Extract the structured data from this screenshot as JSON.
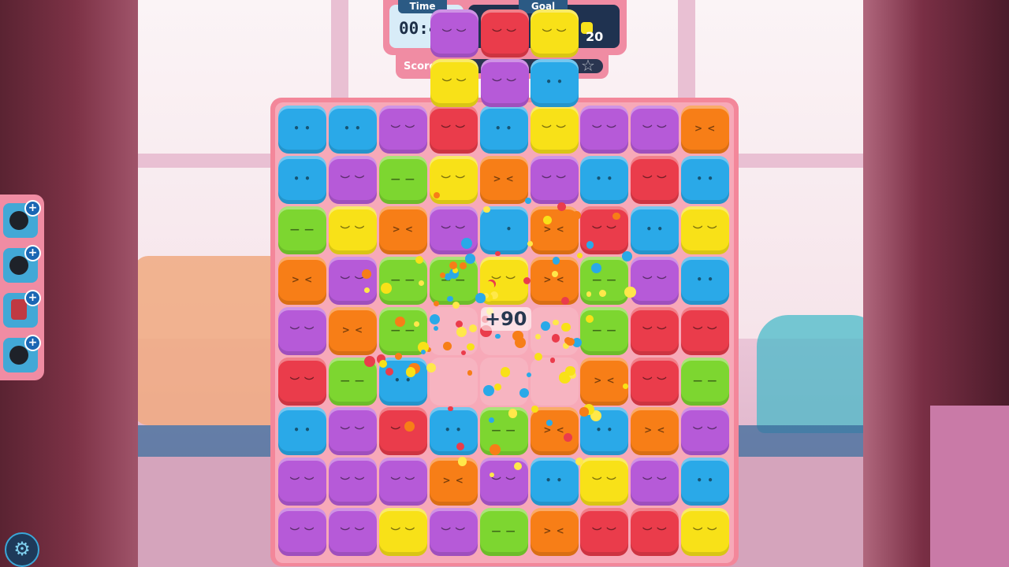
{
  "hud": {
    "time_label": "Time",
    "time_value": "00:4",
    "goal_label": "Goal",
    "goal_count": "20",
    "goal_icon": "yellow-cube-icon",
    "score_label": "Score",
    "score_star": "☆"
  },
  "score_popup": "+90",
  "board": {
    "colors": {
      "blue": "#2aa9e8",
      "purple": "#b65ad8",
      "green": "#7dd630",
      "yellow": "#f8e118",
      "orange": "#f77e17",
      "red": "#ea3c4b"
    },
    "grid": [
      [
        "blue",
        "blue",
        "purple",
        "red",
        "blue",
        "yellow",
        "purple",
        "purple",
        "orange"
      ],
      [
        "blue",
        "purple",
        "green",
        "yellow",
        "orange",
        "purple",
        "blue",
        "red",
        "blue"
      ],
      [
        "green",
        "yellow",
        "orange",
        "purple",
        "blue",
        "orange",
        "red",
        "blue",
        "yellow"
      ],
      [
        "orange",
        "purple",
        "green",
        "green",
        "yellow",
        "orange",
        "green",
        "purple",
        "blue"
      ],
      [
        "purple",
        "orange",
        "green",
        "empty",
        "empty",
        "empty",
        "green",
        "red",
        "red"
      ],
      [
        "red",
        "green",
        "blue",
        "empty",
        "empty",
        "empty",
        "orange",
        "red",
        "green"
      ],
      [
        "blue",
        "purple",
        "red",
        "blue",
        "green",
        "orange",
        "blue",
        "orange",
        "purple"
      ],
      [
        "purple",
        "purple",
        "purple",
        "orange",
        "purple",
        "blue",
        "yellow",
        "purple",
        "blue"
      ],
      [
        "purple",
        "purple",
        "yellow",
        "purple",
        "green",
        "orange",
        "red",
        "red",
        "yellow"
      ]
    ],
    "falling": [
      [
        "purple",
        "red",
        "yellow"
      ],
      [
        "yellow",
        "purple",
        "blue"
      ]
    ]
  },
  "boosters": [
    {
      "icon": "bomb-icon",
      "plus": "+"
    },
    {
      "icon": "bomb-icon",
      "plus": "+"
    },
    {
      "icon": "dynamite-icon",
      "plus": "+"
    },
    {
      "icon": "color-bomb-icon",
      "plus": "+"
    }
  ],
  "settings_icon": "gear-icon"
}
